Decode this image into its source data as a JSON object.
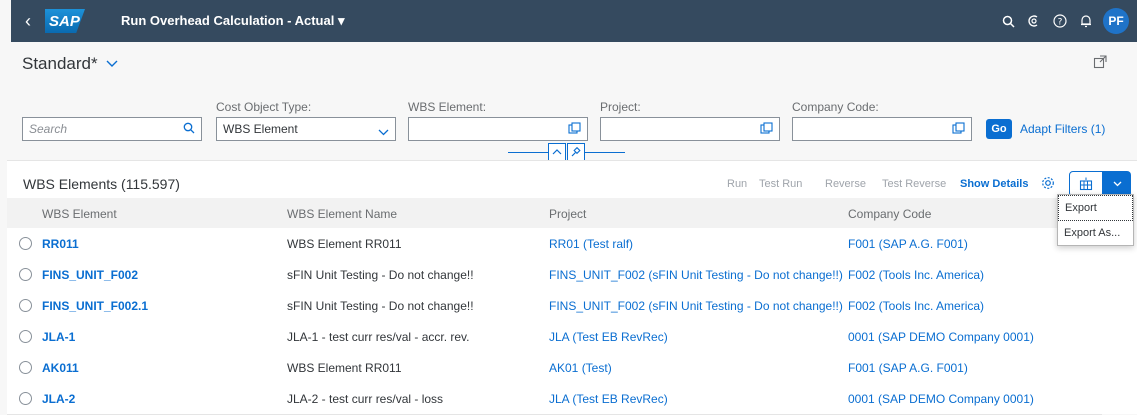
{
  "shell": {
    "title": "Run Overhead Calculation - Actual ▾",
    "logo": "SAP",
    "avatar": "PF",
    "icons": [
      "search-icon",
      "copilot-icon",
      "help-icon",
      "notification-bell-icon"
    ]
  },
  "header": {
    "variant": "Standard*"
  },
  "filters": {
    "search_placeholder": "Search",
    "cost_object_type_label": "Cost Object Type:",
    "cost_object_type_value": "WBS Element",
    "wbs_element_label": "WBS Element:",
    "project_label": "Project:",
    "company_code_label": "Company Code:",
    "go": "Go",
    "adapt": "Adapt Filters (1)"
  },
  "table": {
    "title": "WBS Elements (115.597)",
    "actions": {
      "run": "Run",
      "test_run": "Test Run",
      "reverse": "Reverse",
      "test_reverse": "Test Reverse",
      "show_details": "Show Details"
    },
    "export_menu": [
      "Export",
      "Export As..."
    ],
    "columns": [
      "WBS Element",
      "WBS Element Name",
      "Project",
      "Company Code"
    ],
    "rows": [
      {
        "id": "RR011",
        "name": "WBS Element RR011",
        "project": "RR01 (Test ralf)",
        "company": "F001 (SAP A.G. F001)"
      },
      {
        "id": "FINS_UNIT_F002",
        "name": "sFIN Unit Testing - Do not change!!",
        "project": "FINS_UNIT_F002 (sFIN Unit Testing - Do not change!!)",
        "company": "F002 (Tools Inc. America)"
      },
      {
        "id": "FINS_UNIT_F002.1",
        "name": "sFIN Unit Testing - Do not change!!",
        "project": "FINS_UNIT_F002 (sFIN Unit Testing - Do not change!!)",
        "company": "F002 (Tools Inc. America)"
      },
      {
        "id": "JLA-1",
        "name": "JLA-1 - test curr res/val - accr. rev.",
        "project": "JLA (Test EB RevRec)",
        "company": "0001 (SAP DEMO Company 0001)"
      },
      {
        "id": "AK011",
        "name": "WBS Element RR011",
        "project": "AK01 (Test)",
        "company": "F001 (SAP A.G. F001)"
      },
      {
        "id": "JLA-2",
        "name": "JLA-2 - test curr res/val - loss",
        "project": "JLA (Test EB RevRec)",
        "company": "0001 (SAP DEMO Company 0001)"
      }
    ]
  },
  "colors": {
    "shell": "#354a5f",
    "accent": "#0a6ed1",
    "text": "#32363a"
  }
}
